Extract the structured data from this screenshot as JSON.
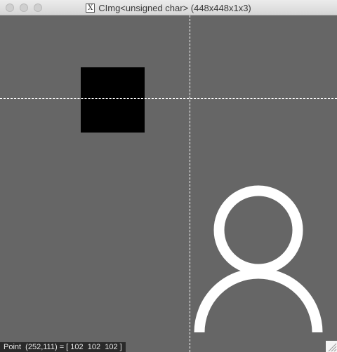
{
  "window": {
    "title": "CImg<unsigned char> (448x448x1x3)",
    "app_icon_glyph": "X"
  },
  "colors": {
    "background": "#666666",
    "square": "#000000",
    "icon": "#ffffff",
    "crosshair": "#ffffff"
  },
  "icons": {
    "app": "x11-icon",
    "figure": "user-icon",
    "grip": "resize-grip-icon"
  },
  "status": {
    "text": "Point  (252,111) = [ 102  102  102 ]"
  }
}
